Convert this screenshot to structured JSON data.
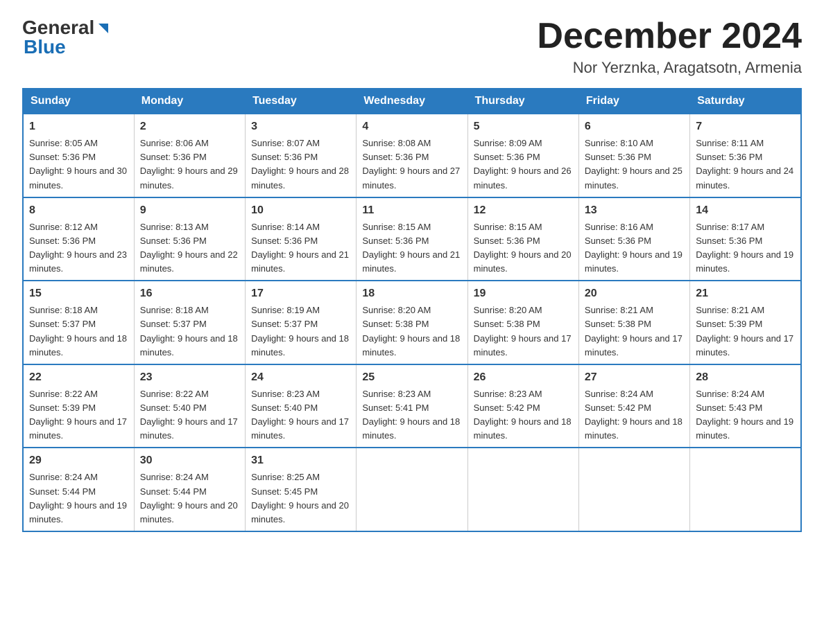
{
  "header": {
    "logo_general": "General",
    "logo_blue": "Blue",
    "month_title": "December 2024",
    "location": "Nor Yerznka, Aragatsotn, Armenia"
  },
  "weekdays": [
    "Sunday",
    "Monday",
    "Tuesday",
    "Wednesday",
    "Thursday",
    "Friday",
    "Saturday"
  ],
  "weeks": [
    [
      {
        "day": "1",
        "sunrise": "8:05 AM",
        "sunset": "5:36 PM",
        "daylight": "9 hours and 30 minutes."
      },
      {
        "day": "2",
        "sunrise": "8:06 AM",
        "sunset": "5:36 PM",
        "daylight": "9 hours and 29 minutes."
      },
      {
        "day": "3",
        "sunrise": "8:07 AM",
        "sunset": "5:36 PM",
        "daylight": "9 hours and 28 minutes."
      },
      {
        "day": "4",
        "sunrise": "8:08 AM",
        "sunset": "5:36 PM",
        "daylight": "9 hours and 27 minutes."
      },
      {
        "day": "5",
        "sunrise": "8:09 AM",
        "sunset": "5:36 PM",
        "daylight": "9 hours and 26 minutes."
      },
      {
        "day": "6",
        "sunrise": "8:10 AM",
        "sunset": "5:36 PM",
        "daylight": "9 hours and 25 minutes."
      },
      {
        "day": "7",
        "sunrise": "8:11 AM",
        "sunset": "5:36 PM",
        "daylight": "9 hours and 24 minutes."
      }
    ],
    [
      {
        "day": "8",
        "sunrise": "8:12 AM",
        "sunset": "5:36 PM",
        "daylight": "9 hours and 23 minutes."
      },
      {
        "day": "9",
        "sunrise": "8:13 AM",
        "sunset": "5:36 PM",
        "daylight": "9 hours and 22 minutes."
      },
      {
        "day": "10",
        "sunrise": "8:14 AM",
        "sunset": "5:36 PM",
        "daylight": "9 hours and 21 minutes."
      },
      {
        "day": "11",
        "sunrise": "8:15 AM",
        "sunset": "5:36 PM",
        "daylight": "9 hours and 21 minutes."
      },
      {
        "day": "12",
        "sunrise": "8:15 AM",
        "sunset": "5:36 PM",
        "daylight": "9 hours and 20 minutes."
      },
      {
        "day": "13",
        "sunrise": "8:16 AM",
        "sunset": "5:36 PM",
        "daylight": "9 hours and 19 minutes."
      },
      {
        "day": "14",
        "sunrise": "8:17 AM",
        "sunset": "5:36 PM",
        "daylight": "9 hours and 19 minutes."
      }
    ],
    [
      {
        "day": "15",
        "sunrise": "8:18 AM",
        "sunset": "5:37 PM",
        "daylight": "9 hours and 18 minutes."
      },
      {
        "day": "16",
        "sunrise": "8:18 AM",
        "sunset": "5:37 PM",
        "daylight": "9 hours and 18 minutes."
      },
      {
        "day": "17",
        "sunrise": "8:19 AM",
        "sunset": "5:37 PM",
        "daylight": "9 hours and 18 minutes."
      },
      {
        "day": "18",
        "sunrise": "8:20 AM",
        "sunset": "5:38 PM",
        "daylight": "9 hours and 18 minutes."
      },
      {
        "day": "19",
        "sunrise": "8:20 AM",
        "sunset": "5:38 PM",
        "daylight": "9 hours and 17 minutes."
      },
      {
        "day": "20",
        "sunrise": "8:21 AM",
        "sunset": "5:38 PM",
        "daylight": "9 hours and 17 minutes."
      },
      {
        "day": "21",
        "sunrise": "8:21 AM",
        "sunset": "5:39 PM",
        "daylight": "9 hours and 17 minutes."
      }
    ],
    [
      {
        "day": "22",
        "sunrise": "8:22 AM",
        "sunset": "5:39 PM",
        "daylight": "9 hours and 17 minutes."
      },
      {
        "day": "23",
        "sunrise": "8:22 AM",
        "sunset": "5:40 PM",
        "daylight": "9 hours and 17 minutes."
      },
      {
        "day": "24",
        "sunrise": "8:23 AM",
        "sunset": "5:40 PM",
        "daylight": "9 hours and 17 minutes."
      },
      {
        "day": "25",
        "sunrise": "8:23 AM",
        "sunset": "5:41 PM",
        "daylight": "9 hours and 18 minutes."
      },
      {
        "day": "26",
        "sunrise": "8:23 AM",
        "sunset": "5:42 PM",
        "daylight": "9 hours and 18 minutes."
      },
      {
        "day": "27",
        "sunrise": "8:24 AM",
        "sunset": "5:42 PM",
        "daylight": "9 hours and 18 minutes."
      },
      {
        "day": "28",
        "sunrise": "8:24 AM",
        "sunset": "5:43 PM",
        "daylight": "9 hours and 19 minutes."
      }
    ],
    [
      {
        "day": "29",
        "sunrise": "8:24 AM",
        "sunset": "5:44 PM",
        "daylight": "9 hours and 19 minutes."
      },
      {
        "day": "30",
        "sunrise": "8:24 AM",
        "sunset": "5:44 PM",
        "daylight": "9 hours and 20 minutes."
      },
      {
        "day": "31",
        "sunrise": "8:25 AM",
        "sunset": "5:45 PM",
        "daylight": "9 hours and 20 minutes."
      },
      null,
      null,
      null,
      null
    ]
  ]
}
